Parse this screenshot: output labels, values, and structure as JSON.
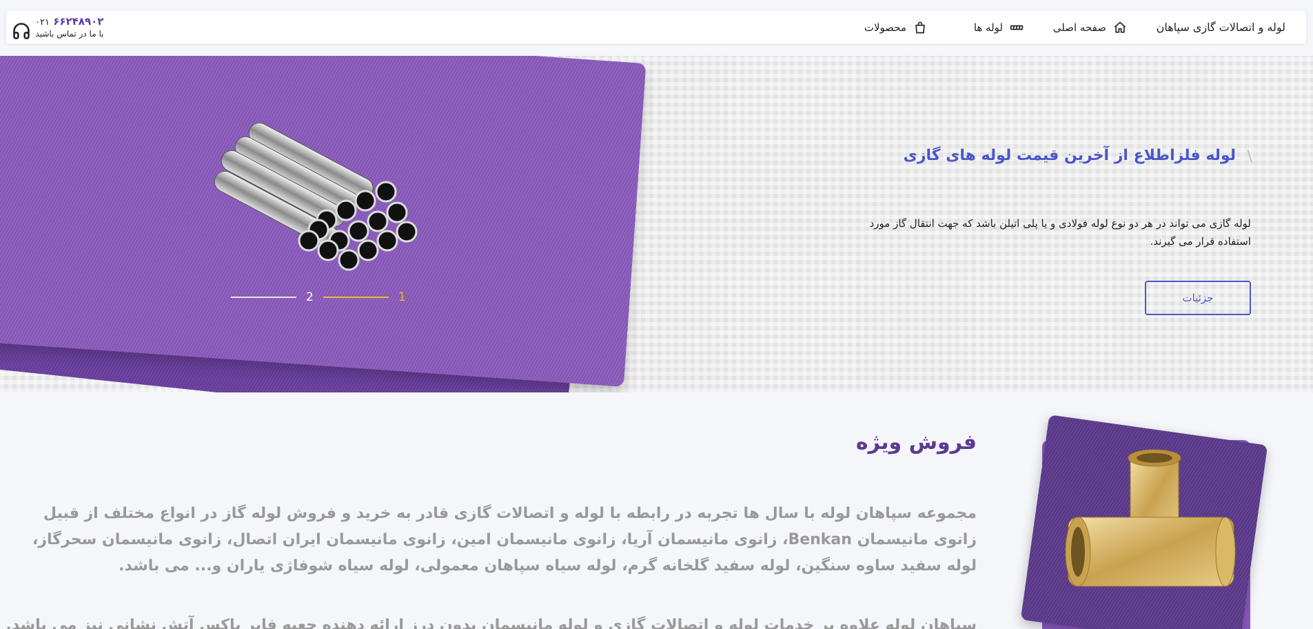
{
  "header": {
    "brand": "لوله و اتصالات گازی سپاهان",
    "nav": [
      {
        "label": "صفحه اصلی",
        "icon": "home-icon"
      },
      {
        "label": "لوله ها",
        "icon": "pipe-icon"
      },
      {
        "label": "محصولات",
        "icon": "shopping-bag-icon"
      }
    ],
    "contact": {
      "phone_prefix": "۰۲۱",
      "phone_number": "۶۶۲۴۸۹۰۲",
      "subtitle": "با ما در تماس باشید",
      "icon": "headset-icon"
    }
  },
  "hero": {
    "title": "لوله فلزاطلاع از آخرین قیمت لوله های گازی",
    "text": "لوله گازی می تواند در هر دو نوع لوله فولادی و یا پلی اتیلن باشد که جهت انتقال گاز مورد استفاده قرار می گیرند.",
    "button": "جزئیات",
    "slides": [
      "1",
      "2"
    ],
    "active_slide": 1,
    "colors": {
      "accent": "#4a56c9",
      "active_dot": "#f1b531",
      "slide_bg": "#8a5bbd"
    }
  },
  "special": {
    "title": "فروش ویژه",
    "text": "مجموعه سپاهان لوله با سال ها تجربه در رابطه با لوله و اتصالات گازی قادر به خرید و فروش لوله گاز در انواع مختلف از قبیل زانوی مانیسمان Benkan، زانوی مانیسمان آریا، زانوی مانیسمان امین، زانوی مانیسمان ایران اتصال، زانوی مانیسمان سحرگاز، لوله سفید ساوه سنگین، لوله سفید گلخانه گرم، لوله سیاه سپاهان معمولی، لوله سیاه شوفاژی یاران و... می باشد.",
    "text2": "سپاهان لوله علاوه بر خدمات لوله و اتصالات گازی و لوله مانیسمان بدون درز ارائه دهنده جعبه فایر باکس آتش نشانی نیز می باشد. مشتریان گرامی"
  }
}
